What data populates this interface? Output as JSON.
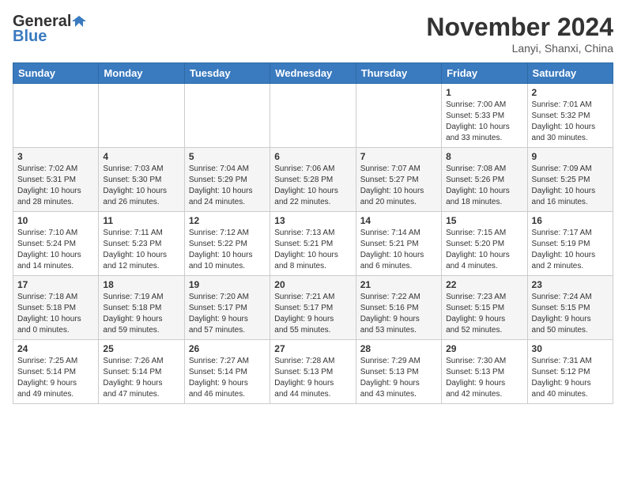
{
  "header": {
    "logo_line1": "General",
    "logo_line2": "Blue",
    "month_title": "November 2024",
    "location": "Lanyi, Shanxi, China"
  },
  "weekdays": [
    "Sunday",
    "Monday",
    "Tuesday",
    "Wednesday",
    "Thursday",
    "Friday",
    "Saturday"
  ],
  "weeks": [
    [
      {
        "day": "",
        "info": ""
      },
      {
        "day": "",
        "info": ""
      },
      {
        "day": "",
        "info": ""
      },
      {
        "day": "",
        "info": ""
      },
      {
        "day": "",
        "info": ""
      },
      {
        "day": "1",
        "info": "Sunrise: 7:00 AM\nSunset: 5:33 PM\nDaylight: 10 hours\nand 33 minutes."
      },
      {
        "day": "2",
        "info": "Sunrise: 7:01 AM\nSunset: 5:32 PM\nDaylight: 10 hours\nand 30 minutes."
      }
    ],
    [
      {
        "day": "3",
        "info": "Sunrise: 7:02 AM\nSunset: 5:31 PM\nDaylight: 10 hours\nand 28 minutes."
      },
      {
        "day": "4",
        "info": "Sunrise: 7:03 AM\nSunset: 5:30 PM\nDaylight: 10 hours\nand 26 minutes."
      },
      {
        "day": "5",
        "info": "Sunrise: 7:04 AM\nSunset: 5:29 PM\nDaylight: 10 hours\nand 24 minutes."
      },
      {
        "day": "6",
        "info": "Sunrise: 7:06 AM\nSunset: 5:28 PM\nDaylight: 10 hours\nand 22 minutes."
      },
      {
        "day": "7",
        "info": "Sunrise: 7:07 AM\nSunset: 5:27 PM\nDaylight: 10 hours\nand 20 minutes."
      },
      {
        "day": "8",
        "info": "Sunrise: 7:08 AM\nSunset: 5:26 PM\nDaylight: 10 hours\nand 18 minutes."
      },
      {
        "day": "9",
        "info": "Sunrise: 7:09 AM\nSunset: 5:25 PM\nDaylight: 10 hours\nand 16 minutes."
      }
    ],
    [
      {
        "day": "10",
        "info": "Sunrise: 7:10 AM\nSunset: 5:24 PM\nDaylight: 10 hours\nand 14 minutes."
      },
      {
        "day": "11",
        "info": "Sunrise: 7:11 AM\nSunset: 5:23 PM\nDaylight: 10 hours\nand 12 minutes."
      },
      {
        "day": "12",
        "info": "Sunrise: 7:12 AM\nSunset: 5:22 PM\nDaylight: 10 hours\nand 10 minutes."
      },
      {
        "day": "13",
        "info": "Sunrise: 7:13 AM\nSunset: 5:21 PM\nDaylight: 10 hours\nand 8 minutes."
      },
      {
        "day": "14",
        "info": "Sunrise: 7:14 AM\nSunset: 5:21 PM\nDaylight: 10 hours\nand 6 minutes."
      },
      {
        "day": "15",
        "info": "Sunrise: 7:15 AM\nSunset: 5:20 PM\nDaylight: 10 hours\nand 4 minutes."
      },
      {
        "day": "16",
        "info": "Sunrise: 7:17 AM\nSunset: 5:19 PM\nDaylight: 10 hours\nand 2 minutes."
      }
    ],
    [
      {
        "day": "17",
        "info": "Sunrise: 7:18 AM\nSunset: 5:18 PM\nDaylight: 10 hours\nand 0 minutes."
      },
      {
        "day": "18",
        "info": "Sunrise: 7:19 AM\nSunset: 5:18 PM\nDaylight: 9 hours\nand 59 minutes."
      },
      {
        "day": "19",
        "info": "Sunrise: 7:20 AM\nSunset: 5:17 PM\nDaylight: 9 hours\nand 57 minutes."
      },
      {
        "day": "20",
        "info": "Sunrise: 7:21 AM\nSunset: 5:17 PM\nDaylight: 9 hours\nand 55 minutes."
      },
      {
        "day": "21",
        "info": "Sunrise: 7:22 AM\nSunset: 5:16 PM\nDaylight: 9 hours\nand 53 minutes."
      },
      {
        "day": "22",
        "info": "Sunrise: 7:23 AM\nSunset: 5:15 PM\nDaylight: 9 hours\nand 52 minutes."
      },
      {
        "day": "23",
        "info": "Sunrise: 7:24 AM\nSunset: 5:15 PM\nDaylight: 9 hours\nand 50 minutes."
      }
    ],
    [
      {
        "day": "24",
        "info": "Sunrise: 7:25 AM\nSunset: 5:14 PM\nDaylight: 9 hours\nand 49 minutes."
      },
      {
        "day": "25",
        "info": "Sunrise: 7:26 AM\nSunset: 5:14 PM\nDaylight: 9 hours\nand 47 minutes."
      },
      {
        "day": "26",
        "info": "Sunrise: 7:27 AM\nSunset: 5:14 PM\nDaylight: 9 hours\nand 46 minutes."
      },
      {
        "day": "27",
        "info": "Sunrise: 7:28 AM\nSunset: 5:13 PM\nDaylight: 9 hours\nand 44 minutes."
      },
      {
        "day": "28",
        "info": "Sunrise: 7:29 AM\nSunset: 5:13 PM\nDaylight: 9 hours\nand 43 minutes."
      },
      {
        "day": "29",
        "info": "Sunrise: 7:30 AM\nSunset: 5:13 PM\nDaylight: 9 hours\nand 42 minutes."
      },
      {
        "day": "30",
        "info": "Sunrise: 7:31 AM\nSunset: 5:12 PM\nDaylight: 9 hours\nand 40 minutes."
      }
    ]
  ]
}
